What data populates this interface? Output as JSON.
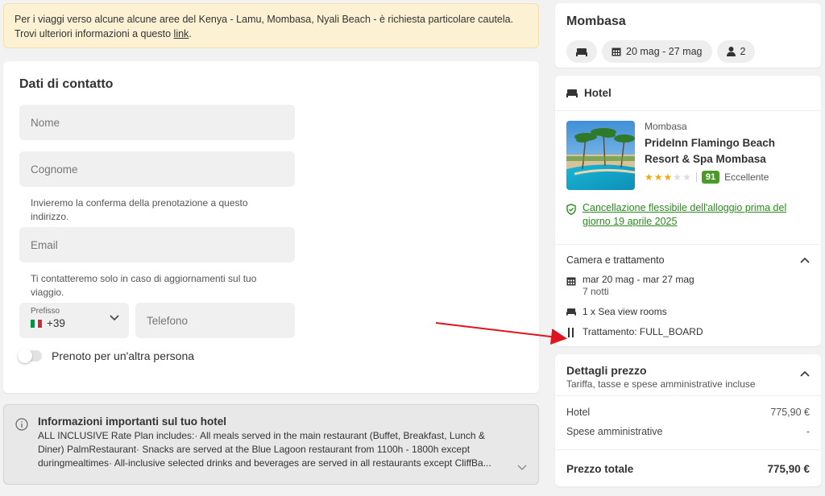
{
  "warning": {
    "line1": "Per i viaggi verso alcune alcune aree del Kenya - Lamu, Mombasa, Nyali Beach - è richiesta particolare cautela.",
    "line2_prefix": "Trovi ulteriori informazioni a questo ",
    "link": "link",
    "line2_suffix": "."
  },
  "contact": {
    "title": "Dati di contatto",
    "first_name_placeholder": "Nome",
    "last_name_placeholder": "Cognome",
    "email_hint": "Invieremo la conferma della prenotazione a questo indirizzo.",
    "email_placeholder": "Email",
    "phone_hint": "Ti contatteremo solo in caso di aggiornamenti sul tuo viaggio.",
    "prefix_label": "Prefisso",
    "prefix_value": "+39",
    "phone_placeholder": "Telefono",
    "other_person_label": "Prenoto per un'altra persona"
  },
  "hotel_info": {
    "title": "Informazioni importanti sul tuo hotel",
    "text": "ALL INCLUSIVE Rate Plan includes:· All meals served in the main restaurant (Buffet, Breakfast, Lunch & Diner) PalmRestaurant· Snacks are served at the Blue Lagoon restaurant from 1100h - 1800h except duringmealtimes· All-inclusive selected drinks and beverages are served in all restaurants except CliffBa..."
  },
  "summary": {
    "destination": "Mombasa",
    "dates": "20 mag - 27 mag",
    "guests": "2"
  },
  "hotel": {
    "section_title": "Hotel",
    "city": "Mombasa",
    "name": "PrideInn Flamingo Beach Resort & Spa Mombasa",
    "stars": 3,
    "score": "91",
    "score_label": "Eccellente",
    "cancellation": "Cancellazione flessibile dell'alloggio prima del giorno 19 aprile 2025",
    "room_title": "Camera e trattamento",
    "dates": "mar 20 mag - mar 27 mag",
    "nights": "7 notti",
    "room": "1 x Sea view rooms",
    "board": "Trattamento: FULL_BOARD"
  },
  "price": {
    "title": "Dettagli prezzo",
    "subtitle": "Tariffa, tasse e spese amministrative incluse",
    "rows": [
      {
        "label": "Hotel",
        "value": "775,90 €"
      },
      {
        "label": "Spese amministrative",
        "value": "-"
      }
    ],
    "total_label": "Prezzo totale",
    "total_value": "775,90 €"
  },
  "colors": {
    "accent_green": "#2b8a1e",
    "score_bg": "#4c9a2a",
    "star": "#f2a900",
    "arrow": "#e0141e"
  }
}
